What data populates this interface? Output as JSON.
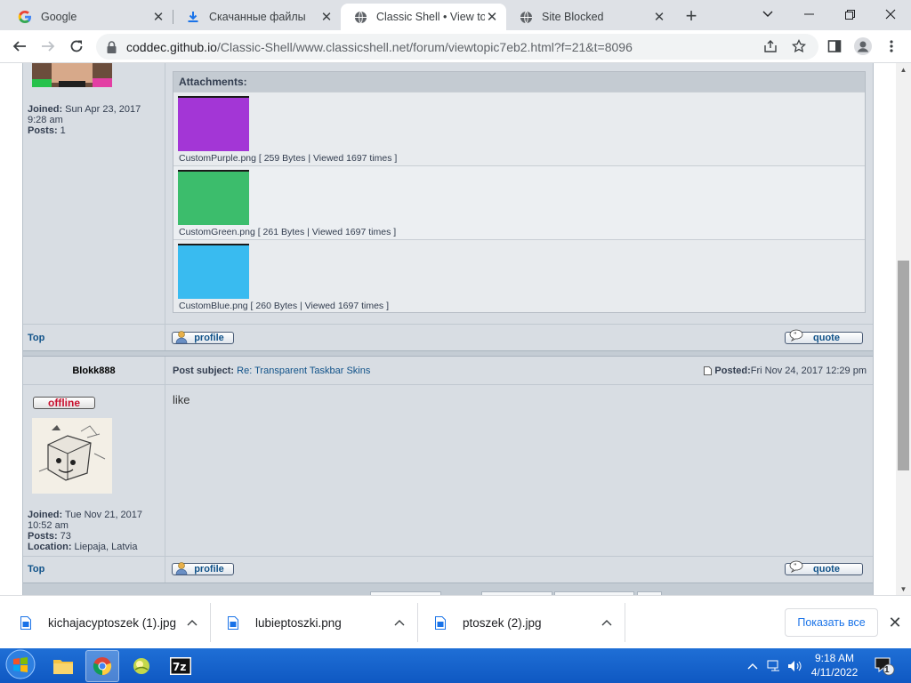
{
  "browser": {
    "tabs": [
      {
        "title": "Google",
        "icon": "google-icon"
      },
      {
        "title": "Скачанные файлы",
        "icon": "download-icon"
      },
      {
        "title": "Classic Shell • View top",
        "icon": "globe-icon"
      },
      {
        "title": "Site Blocked",
        "icon": "globe-icon"
      }
    ],
    "url_host": "coddec.github.io",
    "url_rest": "/Classic-Shell/www.classicshell.net/forum/viewtopic7eb2.html?f=21&t=8096"
  },
  "post1": {
    "joined_label": "Joined:",
    "joined_value": " Sun Apr 23, 2017",
    "joined_time": "9:28 am",
    "posts_label": "Posts:",
    "posts_value": " 1",
    "attachments_title": "Attachments:",
    "attachments": [
      {
        "name": "CustomPurple.png",
        "meta": " [ 259 Bytes | Viewed 1697 times ]",
        "color": "#a336d6"
      },
      {
        "name": "CustomGreen.png",
        "meta": " [ 261 Bytes | Viewed 1697 times ]",
        "color": "#3cbd6c"
      },
      {
        "name": "CustomBlue.png",
        "meta": " [ 260 Bytes | Viewed 1697 times ]",
        "color": "#39bbf0"
      }
    ],
    "top_link": "Top",
    "profile_btn": "profile",
    "quote_btn": "quote"
  },
  "post2": {
    "author": "Blokk888",
    "subject_label": "Post subject:",
    "subject_value": "Re: Transparent Taskbar Skins",
    "posted_label": "Posted:",
    "posted_value": " Fri Nov 24, 2017 12:29 pm",
    "status": "offline",
    "body": "like",
    "joined_label": "Joined:",
    "joined_value": " Tue Nov 21, 2017",
    "joined_time": "10:52 am",
    "posts_label": "Posts:",
    "posts_value": " 73",
    "location_label": "Location:",
    "location_value": " Liepaja, Latvia",
    "top_link": "Top",
    "profile_btn": "profile",
    "quote_btn": "quote"
  },
  "downloads": {
    "items": [
      {
        "name": "kichajacyptoszek (1).jpg"
      },
      {
        "name": "lubieptoszki.png"
      },
      {
        "name": "ptoszek (2).jpg"
      }
    ],
    "show_all": "Показать все"
  },
  "taskbar": {
    "time": "9:18 AM",
    "date": "4/11/2022",
    "notification_count": "1"
  }
}
